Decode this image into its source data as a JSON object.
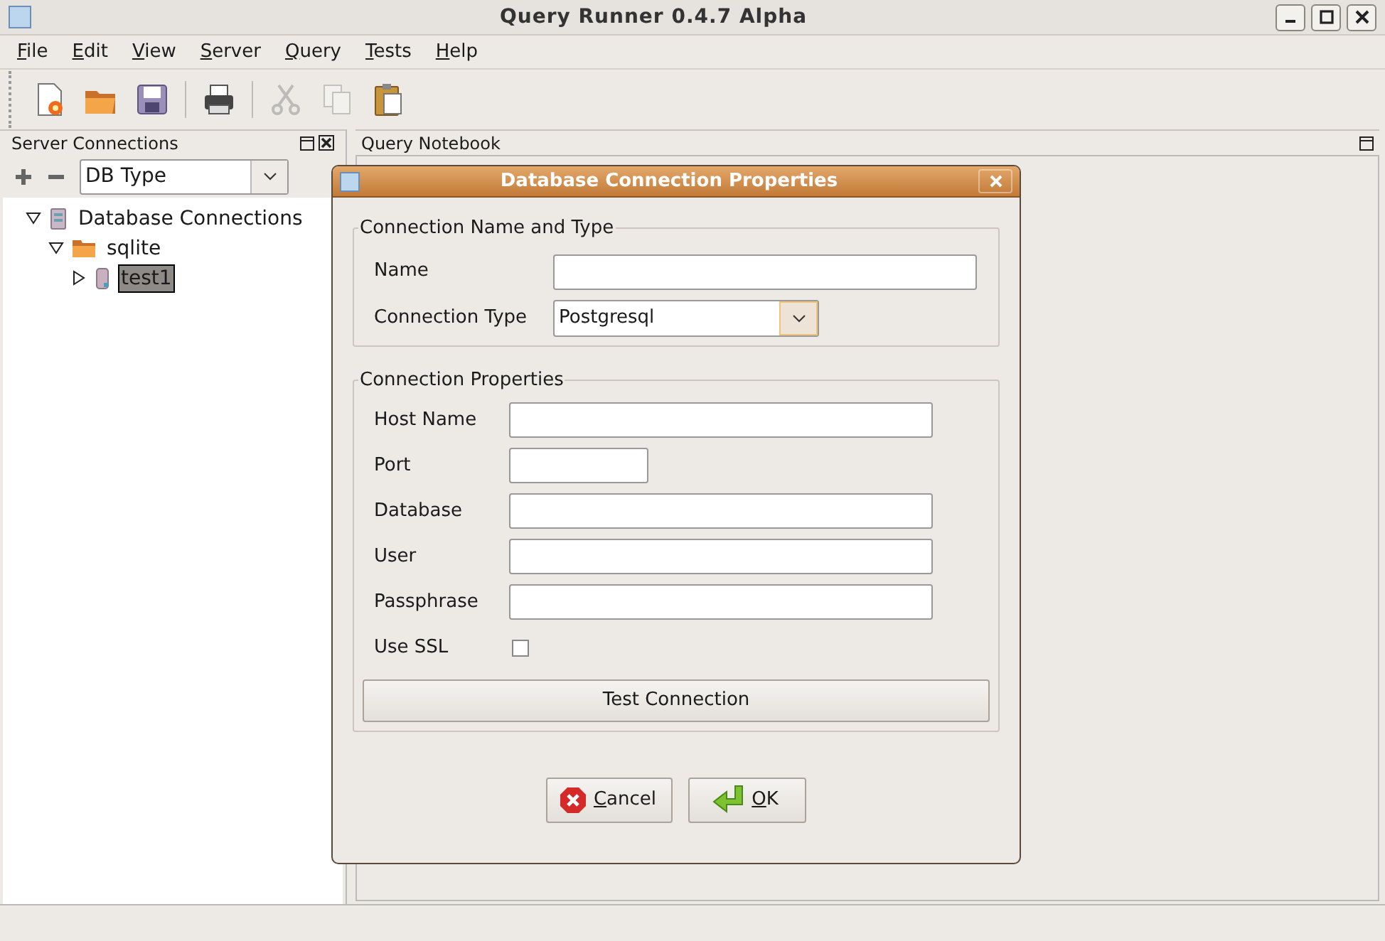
{
  "window": {
    "title": "Query Runner 0.4.7 Alpha"
  },
  "menu": [
    "File",
    "Edit",
    "View",
    "Server",
    "Query",
    "Tests",
    "Help"
  ],
  "toolbar": [
    {
      "kind": "new",
      "disabled": false
    },
    {
      "kind": "open",
      "disabled": false
    },
    {
      "kind": "save",
      "disabled": false
    },
    {
      "kind": "separator"
    },
    {
      "kind": "print",
      "disabled": false
    },
    {
      "kind": "separator"
    },
    {
      "kind": "cut",
      "disabled": true
    },
    {
      "kind": "copy",
      "disabled": true
    },
    {
      "kind": "paste",
      "disabled": false
    }
  ],
  "server_panel": {
    "title": "Server Connections",
    "db_type": "DB Type",
    "tree": [
      {
        "label": "Database Connections",
        "kind": "server",
        "expanded": true,
        "selected": false,
        "children": [
          {
            "label": "sqlite",
            "kind": "folder",
            "expanded": true,
            "selected": false,
            "children": [
              {
                "label": "test1",
                "kind": "database",
                "expanded": false,
                "selected": true
              }
            ]
          }
        ]
      }
    ]
  },
  "notebook": {
    "title": "Query Notebook"
  },
  "dialog": {
    "title": "Database Connection Properties",
    "group1": {
      "title": "Connection Name and Type",
      "name_label": "Name",
      "type_label": "Connection Type",
      "type_value": "Postgresql"
    },
    "group2": {
      "title": "Connection Properties",
      "fields": [
        {
          "label": "Host Name",
          "kind": "wide"
        },
        {
          "label": "Port",
          "kind": "short"
        },
        {
          "label": "Database",
          "kind": "wide"
        },
        {
          "label": "User",
          "kind": "wide"
        },
        {
          "label": "Passphrase",
          "kind": "wide"
        },
        {
          "label": "Use SSL",
          "kind": "checkbox",
          "checked": false
        }
      ],
      "test_button": "Test Connection"
    },
    "buttons": [
      {
        "label": "Cancel",
        "kind": "cancel"
      },
      {
        "label": "OK",
        "kind": "ok"
      }
    ]
  }
}
